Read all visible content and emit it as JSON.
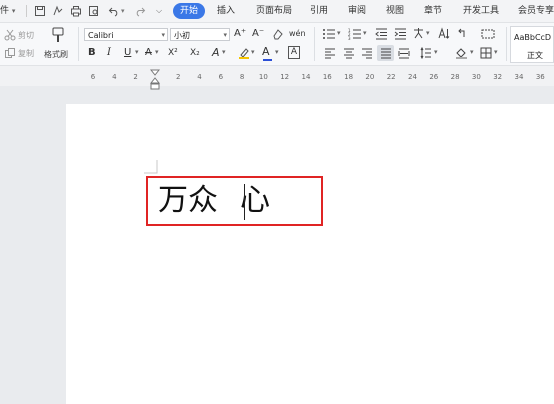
{
  "menu": {
    "file_fragment": "件",
    "file_chevron": "▾",
    "tabs": [
      "开始",
      "插入",
      "页面布局",
      "引用",
      "审阅",
      "视图",
      "章节",
      "开发工具",
      "会员专享"
    ]
  },
  "ribbon": {
    "cut_label": "剪切",
    "copy_label": "复制",
    "format_painter_label": "格式刷",
    "font_name": "Calibri",
    "font_size": "小初",
    "style_preview": "AaBbCcD",
    "style_name": "正文",
    "bold": "B",
    "italic": "I",
    "underline": "U",
    "grow_font": "A⁺",
    "shrink_font": "A⁻",
    "superscript": "X²",
    "subscript": "X₂",
    "font_color": "A",
    "char_border": "A",
    "phonetic": "wén"
  },
  "ruler": {
    "ticks": [
      "6",
      "4",
      "2",
      "",
      "2",
      "4",
      "6",
      "8",
      "10",
      "12",
      "14",
      "16",
      "18",
      "20",
      "22",
      "24",
      "26",
      "28",
      "30",
      "32",
      "34",
      "36",
      "38"
    ]
  },
  "document": {
    "text_before_caret": "万众",
    "text_after_caret": "心"
  },
  "colors": {
    "accent": "#3b78e7",
    "highlight_border": "#e02424"
  }
}
